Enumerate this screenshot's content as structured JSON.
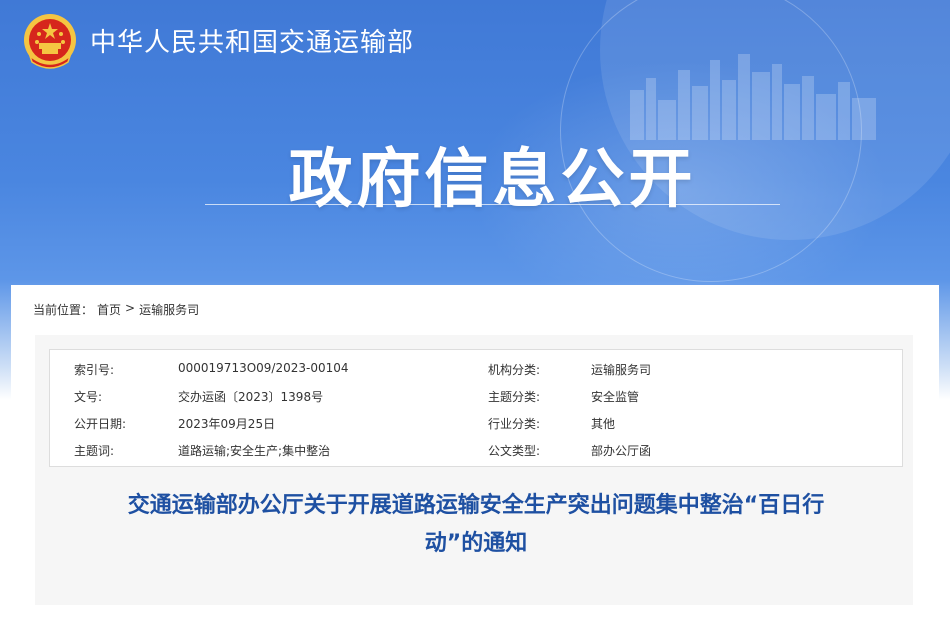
{
  "site": {
    "name": "中华人民共和国交通运输部"
  },
  "hero": {
    "title": "政府信息公开"
  },
  "breadcrumb": {
    "label": "当前位置：",
    "items": [
      "首页",
      "运输服务司"
    ],
    "separator": ">"
  },
  "meta": {
    "rows": [
      {
        "k1": "索引号:",
        "v1": "000019713O09/2023-00104",
        "k2": "机构分类:",
        "v2": "运输服务司"
      },
      {
        "k1": "文号:",
        "v1": "交办运函〔2023〕1398号",
        "k2": "主题分类:",
        "v2": "安全监管"
      },
      {
        "k1": "公开日期:",
        "v1": "2023年09月25日",
        "k2": "行业分类:",
        "v2": "其他"
      },
      {
        "k1": "主题词:",
        "v1": "道路运输;安全生产;集中整治",
        "k2": "公文类型:",
        "v2": "部办公厅函"
      }
    ]
  },
  "article": {
    "title_line1": "交通运输部办公厅关于开展道路运输安全生产突出问题集中整治“百日行",
    "title_line2": "动”的通知"
  },
  "colors": {
    "banner": "#4a86e0",
    "title_blue": "#1e50a2",
    "emblem_red": "#d6261c",
    "emblem_gold": "#f5c542"
  },
  "icons": {
    "emblem": "national-emblem-icon"
  }
}
